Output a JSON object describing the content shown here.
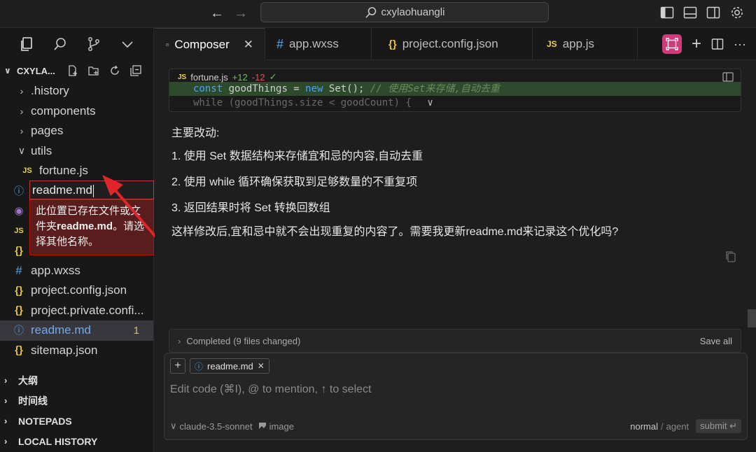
{
  "titlebar": {
    "search_text": "cxylaohuangli"
  },
  "sidebar": {
    "explorer_title": "CXYLA...",
    "tree": [
      {
        "label": ".history",
        "kind": "folder",
        "state": "collapsed"
      },
      {
        "label": "components",
        "kind": "folder",
        "state": "collapsed"
      },
      {
        "label": "pages",
        "kind": "folder",
        "state": "collapsed"
      },
      {
        "label": "utils",
        "kind": "folder",
        "state": "expanded"
      },
      {
        "label": "fortune.js",
        "kind": "js"
      },
      {
        "label": "app.wxss",
        "kind": "wxss"
      },
      {
        "label": "project.config.json",
        "kind": "json"
      },
      {
        "label": "project.private.confi...",
        "kind": "json"
      },
      {
        "label": "readme.md",
        "kind": "info",
        "badge": "1"
      },
      {
        "label": "sitemap.json",
        "kind": "json"
      }
    ],
    "rename": {
      "value": "readme.md",
      "error_pre": "此位置已存在文",
      "error_hidden_mid": "件或文件夹",
      "error_full_prefix": "此位置已存在文件或文件夹 ",
      "error_bold": "readme.md",
      "error_suffix": "。请选择其他名称。"
    },
    "sections": [
      "大纲",
      "时间线",
      "NOTEPADS",
      "LOCAL HISTORY"
    ]
  },
  "tabs": [
    {
      "label": "Composer",
      "active": true
    },
    {
      "label": "app.wxss"
    },
    {
      "label": "project.config.json"
    },
    {
      "label": "app.js"
    }
  ],
  "code_card": {
    "file": "fortune.js",
    "added": "+12",
    "removed": "-12",
    "line1_kw1": "const",
    "line1_mid": " goodThings = ",
    "line1_kw2": "new",
    "line1_call": " Set();",
    "line1_comment": "  // 使用Set来存储,自动去重",
    "line2": "while (goodThings.size < goodCount) {"
  },
  "message": {
    "heading": "主要改动:",
    "items": [
      "1. 使用 Set 数据结构来存储宜和忌的内容,自动去重",
      "2. 使用 while 循环确保获取到足够数量的不重复项",
      "3. 返回结果时将 Set 转换回数组"
    ],
    "closing": "这样修改后,宜和忌中就不会出现重复的内容了。需要我更新readme.md来记录这个优化吗?"
  },
  "completed": {
    "label": "Completed",
    "detail": "(9 files changed)",
    "save_all": "Save all"
  },
  "composer_input": {
    "chip_label": "readme.md",
    "placeholder": "Edit code (⌘I), @ to mention, ↑ to select",
    "model": "claude-3.5-sonnet",
    "image_label": "image",
    "mode_normal": "normal",
    "mode_sep": "/",
    "mode_agent": "agent",
    "submit": "submit"
  }
}
